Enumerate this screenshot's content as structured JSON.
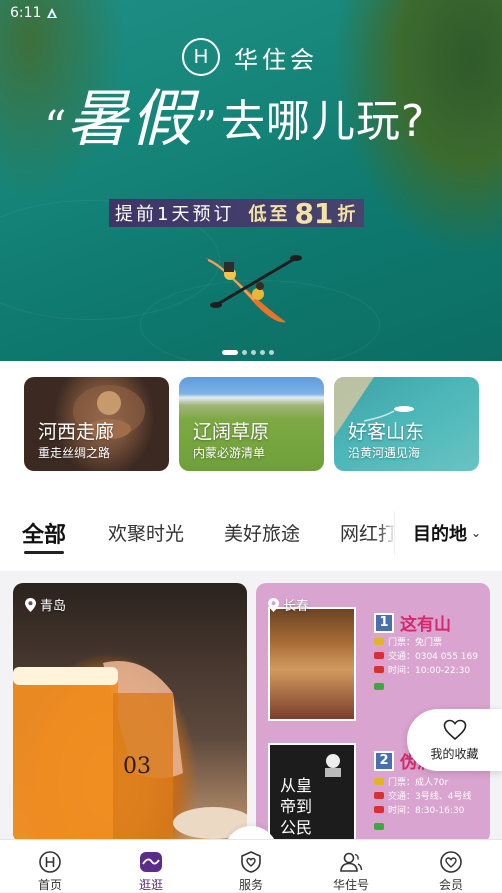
{
  "status_bar": {
    "time": "6:11"
  },
  "hero": {
    "brand_logo_letter": "H",
    "brand_name": "华住会",
    "headline_open_quote": "“",
    "headline_big": "暑假",
    "headline_close_quote": "”",
    "headline_rest": "去哪儿玩?",
    "promo_prefix": "提前1天预订",
    "promo_low": "低至",
    "promo_number": "81",
    "promo_suffix": "折",
    "carousel_total": 5,
    "carousel_active": 1
  },
  "categories": [
    {
      "title": "河西走廊",
      "subtitle": "重走丝绸之路"
    },
    {
      "title": "辽阔草原",
      "subtitle": "内蒙必游清单"
    },
    {
      "title": "好客山东",
      "subtitle": "沿黄河遇见海"
    }
  ],
  "tabs": {
    "items": [
      "全部",
      "欢聚时光",
      "美好旅途",
      "网红打"
    ],
    "active_index": 0,
    "destination_label": "目的地"
  },
  "feed": [
    {
      "location": "青岛"
    },
    {
      "location": "长春",
      "poster": {
        "item1_num": "1",
        "item1_title": "这有山",
        "item1_ticket": "门票：免门票",
        "item1_transport": "交通：0304 055 169",
        "item1_hours": "时间：10:00-22:30",
        "item2_num": "2",
        "item2_title": "伪满",
        "item2_ticket": "门票：成人70r",
        "item2_transport": "交通：3号线、4号线",
        "item2_hours": "时间：8:30-16:30",
        "poster2_text": "从皇帝到公民"
      }
    }
  ],
  "favorites": {
    "label": "我的收藏"
  },
  "bottom_nav": {
    "items": [
      "首页",
      "逛逛",
      "服务",
      "华住号",
      "会员"
    ],
    "active_index": 1,
    "active_color": "#5a2d8a"
  }
}
